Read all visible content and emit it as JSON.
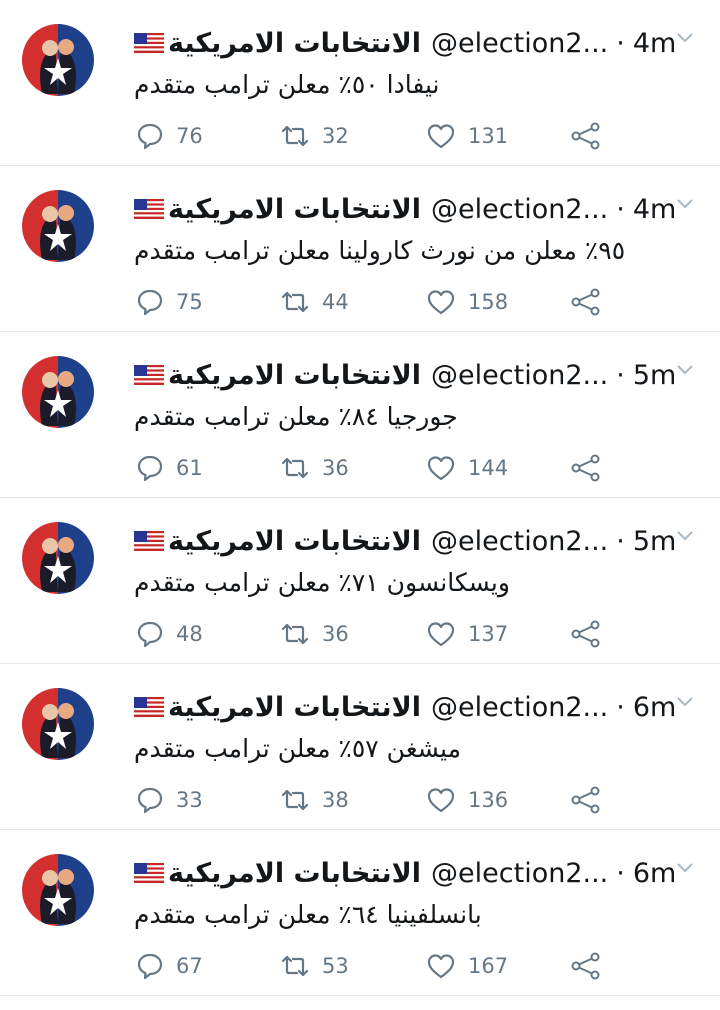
{
  "colors": {
    "text": "#14171a",
    "meta": "#657786",
    "divider": "#e1e8ed",
    "avatar_red": "#d32f2f",
    "avatar_blue": "#1e3f8a"
  },
  "icons": {
    "reply": "comment-bubble-icon",
    "retweet": "retweet-arrows-icon",
    "like": "heart-icon",
    "share": "share-nodes-icon",
    "caret": "chevron-down-icon",
    "flag": "us-flag-icon"
  },
  "tweets": [
    {
      "name": "الانتخابات الامريكية",
      "handle": "@election2...",
      "separator": "·",
      "time": "4m",
      "text": "نيفادا ٥٠٪ معلن ترامب متقدم",
      "replies": "76",
      "retweets": "32",
      "likes": "131"
    },
    {
      "name": "الانتخابات الامريكية",
      "handle": "@election2...",
      "separator": "·",
      "time": "4m",
      "text": "٩٥٪ معلن من نورث كارولينا معلن ترامب متقدم",
      "replies": "75",
      "retweets": "44",
      "likes": "158"
    },
    {
      "name": "الانتخابات الامريكية",
      "handle": "@election2...",
      "separator": "·",
      "time": "5m",
      "text": "جورجيا ٨٤٪ معلن ترامب متقدم",
      "replies": "61",
      "retweets": "36",
      "likes": "144"
    },
    {
      "name": "الانتخابات الامريكية",
      "handle": "@election2...",
      "separator": "·",
      "time": "5m",
      "text": "ويسكانسون ٧١٪ معلن ترامب متقدم",
      "replies": "48",
      "retweets": "36",
      "likes": "137"
    },
    {
      "name": "الانتخابات الامريكية",
      "handle": "@election2...",
      "separator": "·",
      "time": "6m",
      "text": "ميشغن ٥٧٪ معلن ترامب متقدم",
      "replies": "33",
      "retweets": "38",
      "likes": "136"
    },
    {
      "name": "الانتخابات الامريكية",
      "handle": "@election2...",
      "separator": "·",
      "time": "6m",
      "text": "بانسلفينيا ٦٤٪ معلن ترامب متقدم",
      "replies": "67",
      "retweets": "53",
      "likes": "167"
    }
  ]
}
